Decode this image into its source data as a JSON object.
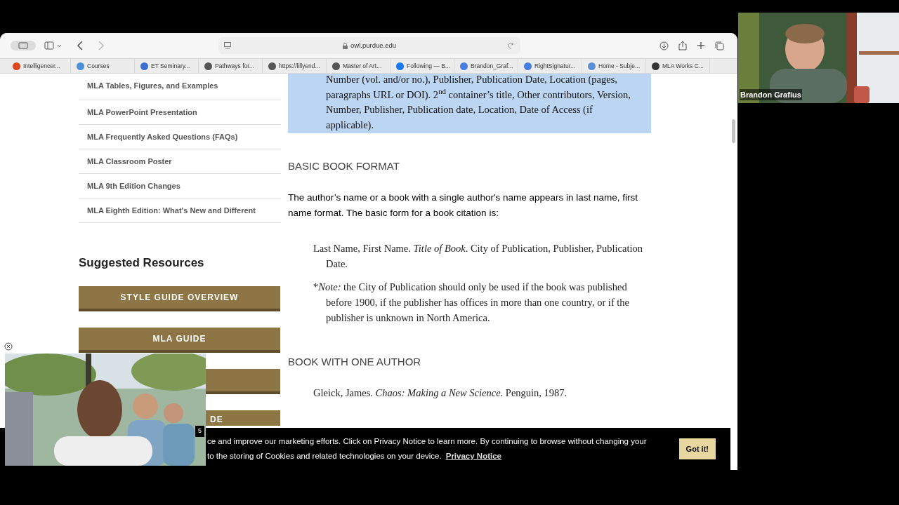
{
  "browser": {
    "url": "owl.purdue.edu",
    "bookmarks": [
      {
        "label": "Intelligencer...",
        "color": "#e0461e"
      },
      {
        "label": "Courses",
        "color": "#4a90d9"
      },
      {
        "label": "ET Seminary...",
        "color": "#3b6fd1"
      },
      {
        "label": "Pathways for...",
        "color": "#555555"
      },
      {
        "label": "https://lillyend...",
        "color": "#555555"
      },
      {
        "label": "Master of Art...",
        "color": "#555555"
      },
      {
        "label": "Following — B...",
        "color": "#1877f2"
      },
      {
        "label": "Brandon_Graf...",
        "color": "#4a7de0"
      },
      {
        "label": "RightSignatur...",
        "color": "#4a7de0"
      },
      {
        "label": "Home - Subje...",
        "color": "#5b8fd6"
      },
      {
        "label": "MLA Works C...",
        "color": "#333333"
      }
    ]
  },
  "sidebar": {
    "links": [
      "MLA Tables, Figures, and Examples",
      "MLA PowerPoint Presentation",
      "MLA Frequently Asked Questions (FAQs)",
      "MLA Classroom Poster",
      "MLA 9th Edition Changes",
      "MLA Eighth Edition: What's New and Different"
    ],
    "suggested_title": "Suggested Resources",
    "buttons": [
      {
        "kind": "full",
        "label": "STYLE GUIDE OVERVIEW"
      },
      {
        "kind": "full",
        "label": "MLA GUIDE"
      },
      {
        "kind": "side_covered"
      },
      {
        "kind": "cut",
        "label": "DE"
      }
    ]
  },
  "article": {
    "highlighted_text": "Number (vol. and/or no.), Publisher, Publication Date, Location (pages, paragraphs URL or DOI). 2$^{nd}$ container’s title, Other contributors, Version, Number, Publisher, Publication date, Location, Date of Access (if applicable).",
    "blocks": [
      {
        "kind": "heading",
        "text": "BASIC BOOK FORMAT"
      },
      {
        "kind": "paragraph",
        "text": "The author’s name or a book with a single author's name appears in last name, first name format. The basic form for a book citation is:"
      },
      {
        "kind": "citation",
        "text": "Last Name, First Name. *Title of Book*. City of Publication, Publisher, Publication Date."
      },
      {
        "kind": "citation",
        "prefix": "*",
        "text": "*Note:* the City of Publication should only be used if the book was published before 1900, if the publisher has offices in more than one country, or if the publisher is unknown in North America."
      },
      {
        "kind": "heading",
        "text": "BOOK WITH ONE AUTHOR"
      },
      {
        "kind": "citation",
        "text": "Gleick, James. *Chaos: Making a New Science*. Penguin, 1987."
      }
    ]
  },
  "cookie_banner": {
    "line_1": "ce and improve our marketing efforts. Click on Privacy Notice to learn more. By continuing to browse without changing your",
    "line_2": "to the storing of Cookies and related technologies on your device.",
    "link": "Privacy Notice",
    "button": "Got it!"
  },
  "video_ad": {
    "kind": "picture",
    "badge": "5"
  },
  "webcam": {
    "kind": "picture",
    "name": "Brandon Grafius"
  }
}
